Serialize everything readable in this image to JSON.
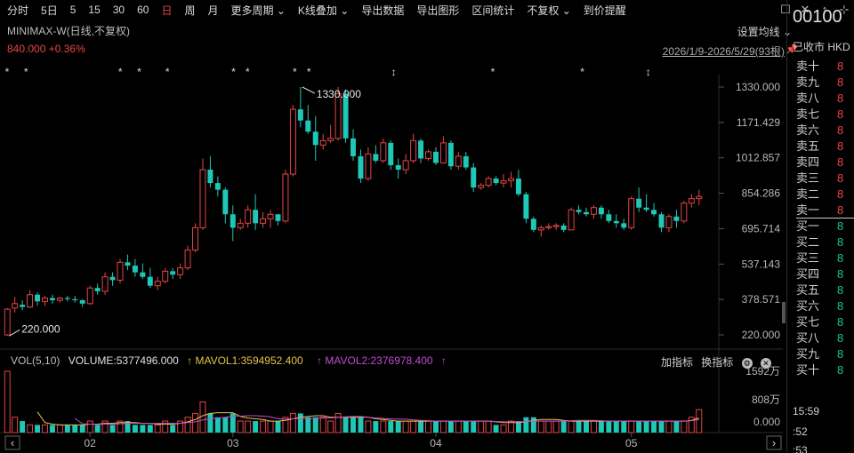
{
  "toolbar": {
    "items": [
      "分时",
      "5日",
      "5",
      "15",
      "30",
      "60",
      "日",
      "周",
      "月",
      "更多周期",
      "K线叠加",
      "导出数据",
      "导出图形",
      "区间统计",
      "不复权",
      "到价提醒"
    ],
    "active_index": 6
  },
  "window_icons": [
    "☐",
    "✕",
    "↑",
    "⊹"
  ],
  "chart_header": {
    "title": "MINIMAX-W(日线,不复权)",
    "price_change": "840.000 +0.36%",
    "overlay_button": "设置均线",
    "range_label": "2026/1/9-2026/5/29(93根)",
    "pin_icon": "pin-icon"
  },
  "price_axis": {
    "ticks": [
      "1330.000",
      "1171.429",
      "1012.857",
      "854.286",
      "695.714",
      "537.143",
      "378.571",
      "220.000"
    ],
    "min": 220,
    "max": 1330
  },
  "annotations": {
    "high_label": "1330.000",
    "low_label": "220.000"
  },
  "markers": [
    "*",
    "*",
    "*",
    "*",
    "*",
    "*",
    "*",
    "*",
    "*",
    "↕",
    "*",
    "*",
    "↕"
  ],
  "time_axis": [
    "02",
    "03",
    "04",
    "05"
  ],
  "volume_panel": {
    "title": "VOL(5,10)",
    "volume": "VOLUME:5377496.000",
    "ma1": "MAVOL1:3594952.400",
    "ma2": "MAVOL2:2376978.400",
    "ticks": [
      "1592万",
      "808万",
      "0.000"
    ],
    "add_indicator": "加指标",
    "change_indicator": "换指标"
  },
  "side_panel": {
    "code": "00100",
    "status": "已收市 HKD",
    "orderbook": [
      {
        "label": "卖十",
        "value": "8",
        "side": "sell"
      },
      {
        "label": "卖九",
        "value": "8",
        "side": "sell"
      },
      {
        "label": "卖八",
        "value": "8",
        "side": "sell"
      },
      {
        "label": "卖七",
        "value": "8",
        "side": "sell"
      },
      {
        "label": "卖六",
        "value": "8",
        "side": "sell"
      },
      {
        "label": "卖五",
        "value": "8",
        "side": "sell"
      },
      {
        "label": "卖四",
        "value": "8",
        "side": "sell"
      },
      {
        "label": "卖三",
        "value": "8",
        "side": "sell"
      },
      {
        "label": "卖二",
        "value": "8",
        "side": "sell"
      },
      {
        "label": "卖一",
        "value": "8",
        "side": "sell"
      },
      {
        "label": "买一",
        "value": "8",
        "side": "buy"
      },
      {
        "label": "买二",
        "value": "8",
        "side": "buy"
      },
      {
        "label": "买三",
        "value": "8",
        "side": "buy"
      },
      {
        "label": "买四",
        "value": "8",
        "side": "buy"
      },
      {
        "label": "买五",
        "value": "8",
        "side": "buy"
      },
      {
        "label": "买六",
        "value": "8",
        "side": "buy"
      },
      {
        "label": "买七",
        "value": "8",
        "side": "buy"
      },
      {
        "label": "买八",
        "value": "8",
        "side": "buy"
      },
      {
        "label": "买九",
        "value": "8",
        "side": "buy"
      },
      {
        "label": "买十",
        "value": "8",
        "side": "buy"
      }
    ],
    "times": [
      "15:59",
      ":52",
      ":53"
    ]
  },
  "colors": {
    "up": "#e64545",
    "down": "#1fc7b6",
    "ma1": "#e6c24a",
    "ma2": "#c14bd3"
  },
  "chart_data": {
    "type": "candlestick",
    "price_range": [
      220,
      1330
    ],
    "candles": [
      [
        220,
        340,
        215,
        335
      ],
      [
        340,
        390,
        320,
        360
      ],
      [
        355,
        375,
        330,
        345
      ],
      [
        345,
        420,
        340,
        400
      ],
      [
        400,
        410,
        350,
        370
      ],
      [
        370,
        395,
        350,
        385
      ],
      [
        385,
        400,
        360,
        375
      ],
      [
        375,
        390,
        365,
        385
      ],
      [
        385,
        395,
        370,
        380
      ],
      [
        380,
        395,
        365,
        375
      ],
      [
        375,
        380,
        345,
        360
      ],
      [
        360,
        440,
        355,
        430
      ],
      [
        430,
        450,
        400,
        415
      ],
      [
        415,
        500,
        400,
        480
      ],
      [
        480,
        500,
        440,
        465
      ],
      [
        465,
        560,
        450,
        545
      ],
      [
        545,
        580,
        510,
        530
      ],
      [
        530,
        560,
        480,
        500
      ],
      [
        500,
        540,
        470,
        480
      ],
      [
        480,
        520,
        430,
        440
      ],
      [
        440,
        480,
        420,
        460
      ],
      [
        460,
        520,
        450,
        505
      ],
      [
        505,
        520,
        470,
        490
      ],
      [
        490,
        540,
        470,
        520
      ],
      [
        520,
        620,
        510,
        600
      ],
      [
        600,
        720,
        590,
        700
      ],
      [
        700,
        1010,
        690,
        960
      ],
      [
        960,
        1020,
        880,
        900
      ],
      [
        900,
        930,
        840,
        870
      ],
      [
        870,
        880,
        720,
        760
      ],
      [
        760,
        800,
        640,
        700
      ],
      [
        700,
        740,
        690,
        720
      ],
      [
        720,
        800,
        700,
        780
      ],
      [
        780,
        850,
        690,
        720
      ],
      [
        720,
        770,
        700,
        740
      ],
      [
        740,
        780,
        700,
        760
      ],
      [
        760,
        760,
        710,
        730
      ],
      [
        730,
        960,
        720,
        940
      ],
      [
        940,
        1250,
        930,
        1230
      ],
      [
        1230,
        1330,
        1150,
        1180
      ],
      [
        1180,
        1250,
        1120,
        1130
      ],
      [
        1130,
        1200,
        1000,
        1070
      ],
      [
        1070,
        1120,
        1050,
        1090
      ],
      [
        1090,
        1160,
        1080,
        1100
      ],
      [
        1100,
        1330,
        1090,
        1300
      ],
      [
        1300,
        1320,
        1080,
        1100
      ],
      [
        1100,
        1140,
        1000,
        1020
      ],
      [
        1020,
        1050,
        900,
        920
      ],
      [
        920,
        1060,
        910,
        1030
      ],
      [
        1030,
        1070,
        990,
        1000
      ],
      [
        1000,
        1100,
        990,
        1080
      ],
      [
        1080,
        1090,
        960,
        980
      ],
      [
        980,
        1010,
        920,
        960
      ],
      [
        960,
        1030,
        940,
        1000
      ],
      [
        1000,
        1120,
        990,
        1090
      ],
      [
        1090,
        1100,
        990,
        1010
      ],
      [
        1010,
        1050,
        1000,
        1040
      ],
      [
        1040,
        1060,
        980,
        990
      ],
      [
        990,
        1110,
        990,
        1080
      ],
      [
        1080,
        1090,
        960,
        975
      ],
      [
        975,
        1040,
        960,
        1020
      ],
      [
        1020,
        1040,
        960,
        970
      ],
      [
        970,
        990,
        860,
        880
      ],
      [
        880,
        900,
        870,
        890
      ],
      [
        890,
        930,
        880,
        920
      ],
      [
        920,
        930,
        890,
        900
      ],
      [
        900,
        940,
        880,
        910
      ],
      [
        910,
        950,
        880,
        920
      ],
      [
        920,
        960,
        840,
        850
      ],
      [
        850,
        860,
        720,
        740
      ],
      [
        740,
        750,
        680,
        690
      ],
      [
        690,
        710,
        660,
        700
      ],
      [
        700,
        720,
        690,
        705
      ],
      [
        705,
        720,
        690,
        710
      ],
      [
        710,
        720,
        680,
        690
      ],
      [
        690,
        790,
        690,
        780
      ],
      [
        780,
        800,
        760,
        770
      ],
      [
        770,
        790,
        750,
        760
      ],
      [
        760,
        800,
        740,
        790
      ],
      [
        790,
        800,
        740,
        760
      ],
      [
        760,
        780,
        720,
        730
      ],
      [
        730,
        760,
        700,
        720
      ],
      [
        720,
        740,
        690,
        700
      ],
      [
        700,
        840,
        690,
        830
      ],
      [
        830,
        880,
        770,
        790
      ],
      [
        790,
        850,
        770,
        780
      ],
      [
        780,
        810,
        750,
        760
      ],
      [
        760,
        770,
        680,
        700
      ],
      [
        700,
        760,
        680,
        750
      ],
      [
        750,
        780,
        700,
        730
      ],
      [
        730,
        820,
        720,
        810
      ],
      [
        810,
        850,
        790,
        830
      ],
      [
        830,
        870,
        800,
        840
      ]
    ],
    "volume": [
      16,
      4,
      3,
      2,
      2,
      2,
      2,
      2,
      2,
      2,
      2,
      3,
      2,
      3,
      2,
      3,
      3,
      2,
      2,
      2,
      2,
      3,
      2,
      3,
      4,
      5,
      8,
      5,
      4,
      4,
      5,
      3,
      3,
      3,
      3,
      3,
      3,
      4,
      5,
      5,
      4,
      4,
      4,
      3,
      5,
      4,
      4,
      4,
      3,
      3,
      3,
      3,
      3,
      3,
      3,
      3,
      3,
      3,
      3,
      3,
      3,
      3,
      3,
      3,
      3,
      2,
      2,
      3,
      3,
      4,
      4,
      3,
      3,
      3,
      3,
      3,
      3,
      3,
      3,
      3,
      3,
      3,
      3,
      3,
      3,
      3,
      3,
      3,
      3,
      3,
      3,
      4,
      6
    ]
  }
}
